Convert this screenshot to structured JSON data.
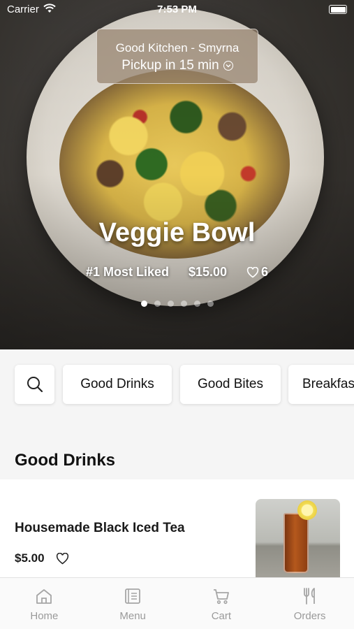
{
  "status_bar": {
    "carrier": "Carrier",
    "time": "7:53 PM"
  },
  "hero": {
    "location": "Good Kitchen - Smyrna",
    "pickup": "Pickup in 15 min",
    "title": "Veggie Bowl",
    "rank": "#1 Most Liked",
    "price": "$15.00",
    "likes": "6",
    "carousel_pages": 6,
    "carousel_active": 1
  },
  "categories": {
    "items": [
      "Good Drinks",
      "Good Bites",
      "Breakfast"
    ]
  },
  "section": {
    "title": "Good Drinks"
  },
  "item": {
    "name": "Housemade Black Iced Tea",
    "price": "$5.00"
  },
  "tabs": [
    {
      "label": "Home",
      "icon": "home-icon"
    },
    {
      "label": "Menu",
      "icon": "menu-icon"
    },
    {
      "label": "Cart",
      "icon": "cart-icon"
    },
    {
      "label": "Orders",
      "icon": "orders-icon"
    }
  ]
}
